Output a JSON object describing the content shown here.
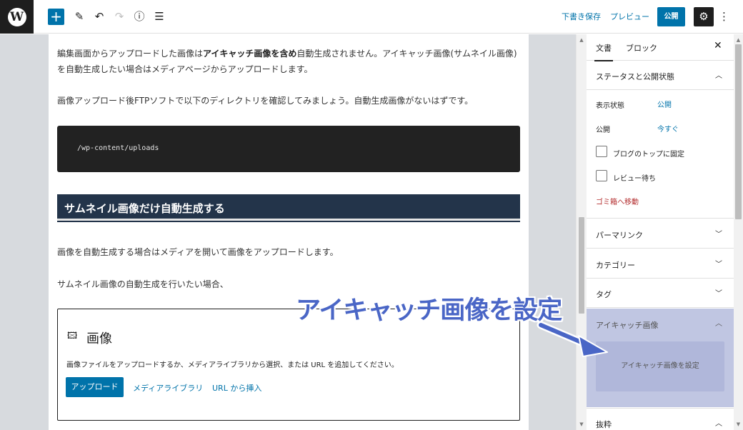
{
  "toolbar": {
    "logo_letter": "W",
    "add_icon": "plus-icon",
    "edit_icon": "pencil-icon",
    "undo_icon": "undo-icon",
    "redo_icon": "redo-icon",
    "info_icon": "info-icon",
    "outline_icon": "list-view-icon",
    "save_draft": "下書き保存",
    "preview": "プレビュー",
    "publish": "公開",
    "settings_icon": "gear-icon",
    "more_icon": "more-vertical-icon"
  },
  "editor": {
    "para1_a": "編集画面からアップロードした画像は",
    "para1_b": "アイキャッチ画像を含め",
    "para1_c": "自動生成されません。アイキャッチ画像(サムネイル画像)を自動生成したい場合はメディアページからアップロードします。",
    "para2": "画像アップロード後FTPソフトで以下のディレクトリを確認してみましょう。自動生成画像がないはずです。",
    "code": "/wp-content/uploads",
    "heading": "サムネイル画像だけ自動生成する",
    "para3": "画像を自動生成する場合はメディアを開いて画像をアップロードします。",
    "para4": "サムネイル画像の自動生成を行いたい場合、",
    "image_block": {
      "icon": "image-icon",
      "title": "画像",
      "description": "画像ファイルをアップロードするか、メディアライブラリから選択、または URL を追加してください。",
      "upload": "アップロード",
      "media_library": "メディアライブラリ",
      "insert_url": "URL から挿入"
    }
  },
  "sidebar": {
    "tab_document": "文書",
    "tab_block": "ブロック",
    "close_icon": "close-icon",
    "status_panel": {
      "title": "ステータスと公開状態",
      "visibility_label": "表示状態",
      "visibility_value": "公開",
      "publish_label": "公開",
      "publish_value": "今すぐ",
      "sticky_label": "ブログのトップに固定",
      "pending_label": "レビュー待ち",
      "trash": "ゴミ箱へ移動"
    },
    "permalink": "パーマリンク",
    "categories": "カテゴリー",
    "tags": "タグ",
    "featured_image": {
      "title": "アイキャッチ画像",
      "set_button": "アイキャッチ画像を設定"
    },
    "excerpt": "抜粋"
  },
  "callout": {
    "text": "アイキャッチ画像を設定",
    "color": "#4a66c6"
  }
}
